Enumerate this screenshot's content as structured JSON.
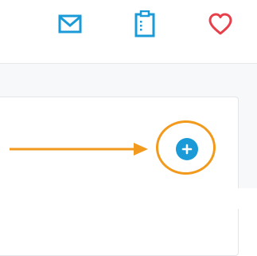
{
  "toolbar": {
    "icons": [
      {
        "name": "mail-icon",
        "color": "#1a9bd7"
      },
      {
        "name": "clipboard-icon",
        "color": "#1a9bd7"
      },
      {
        "name": "heart-icon",
        "color": "#e8404b"
      }
    ]
  },
  "content": {
    "add_button": {
      "icon": "plus-icon",
      "color": "#1a9bd7"
    },
    "annotation": {
      "type": "arrow-and-circle",
      "color": "#f29a1e"
    }
  }
}
